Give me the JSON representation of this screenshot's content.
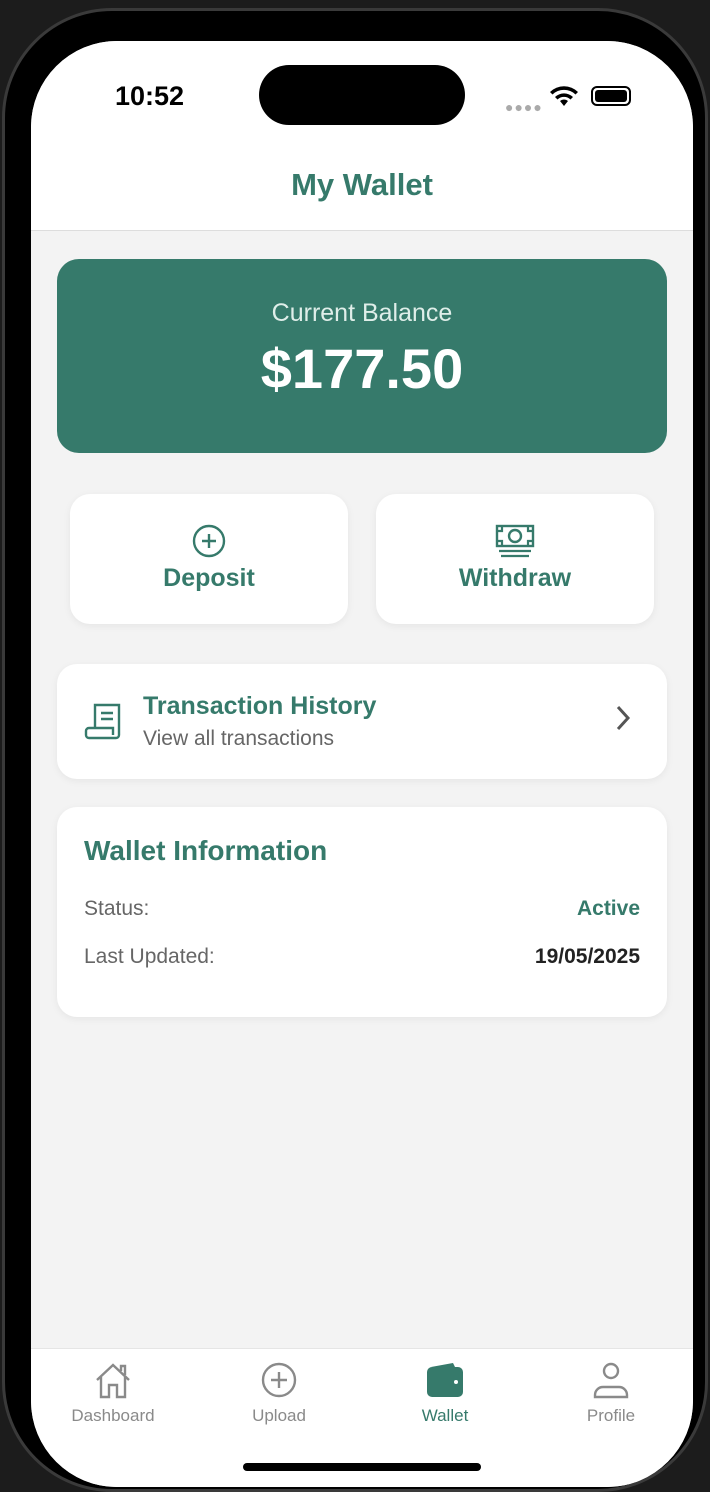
{
  "status_bar": {
    "time": "10:52"
  },
  "header": {
    "title": "My Wallet"
  },
  "balance": {
    "label": "Current Balance",
    "amount": "$177.50"
  },
  "actions": [
    {
      "label": "Deposit",
      "icon": "plus-circle-icon"
    },
    {
      "label": "Withdraw",
      "icon": "cash-icon"
    }
  ],
  "history": {
    "title": "Transaction History",
    "subtitle": "View all transactions",
    "icon": "receipt-icon"
  },
  "wallet_info": {
    "title": "Wallet Information",
    "rows": [
      {
        "label": "Status:",
        "value": "Active"
      },
      {
        "label": "Last Updated:",
        "value": "19/05/2025"
      }
    ]
  },
  "tabs": [
    {
      "label": "Dashboard"
    },
    {
      "label": "Upload"
    },
    {
      "label": "Wallet"
    },
    {
      "label": "Profile"
    }
  ],
  "colors": {
    "accent": "#367a6b",
    "background": "#f3f3f3"
  }
}
